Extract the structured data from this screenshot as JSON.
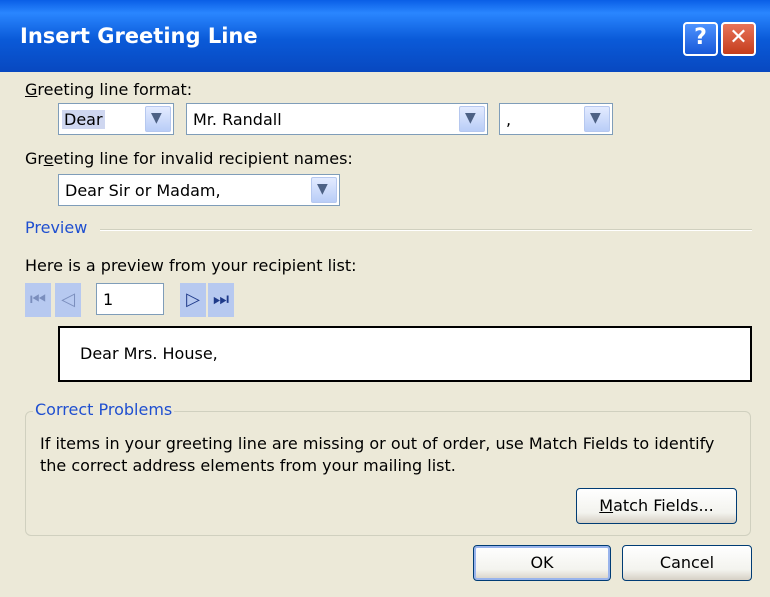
{
  "dialog": {
    "title": "Insert Greeting Line",
    "help_label": "?",
    "close_label": "✕"
  },
  "greeting_format": {
    "label": "Greeting line format:",
    "label_accel": "G",
    "label_rest": "reeting line format:",
    "salutation": "Dear",
    "name_format": "Mr. Randall",
    "punctuation": ","
  },
  "invalid_names": {
    "label_pre": "Gr",
    "label_accel": "e",
    "label_rest": "eting line for invalid recipient names:",
    "value": "Dear Sir or Madam,"
  },
  "preview": {
    "section_label": "Preview",
    "intro": "Here is a preview from your recipient list:",
    "record_number": "1",
    "text": "Dear Mrs. House,"
  },
  "correct_problems": {
    "section_label": "Correct Problems",
    "description": "If items in your greeting line are missing or out of order, use Match Fields to identify the correct address elements from your mailing list.",
    "match_accel": "M",
    "match_rest": "atch Fields..."
  },
  "footer": {
    "ok_label": "OK",
    "cancel_label": "Cancel"
  }
}
